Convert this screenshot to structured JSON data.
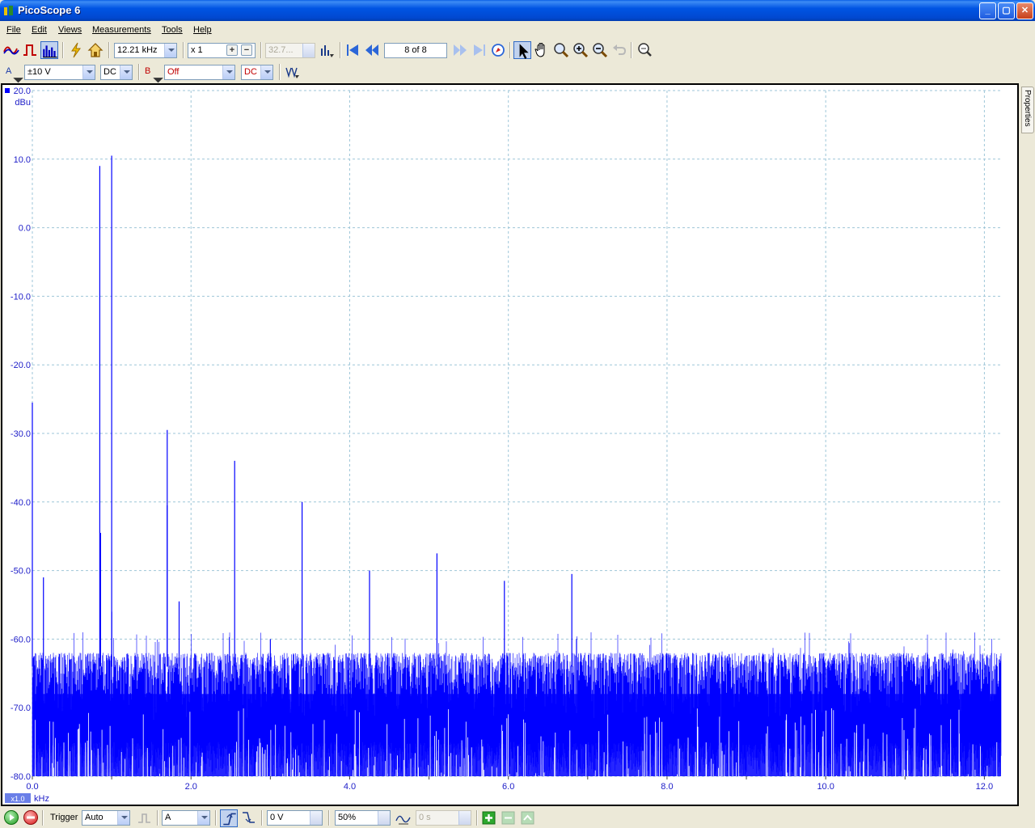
{
  "window": {
    "title": "PicoScope 6"
  },
  "menu": [
    "File",
    "Edit",
    "Views",
    "Measurements",
    "Tools",
    "Help"
  ],
  "toolbar": {
    "frequency": "12.21 kHz",
    "zoom_factor": "x 1",
    "samples": "32.7...",
    "buffer_position": "8 of 8"
  },
  "channels": {
    "a": {
      "label": "A",
      "range": "±10 V",
      "coupling": "DC"
    },
    "b": {
      "label": "B",
      "range": "Off",
      "coupling": "DC"
    }
  },
  "properties_tab": "Properties",
  "trigger": {
    "label": "Trigger",
    "mode": "Auto",
    "source": "A",
    "threshold": "0 V",
    "pre_trigger": "50%",
    "delay": "0 s"
  },
  "chart_data": {
    "type": "line",
    "title": "",
    "xlabel": "kHz",
    "ylabel": "dBu",
    "xlim": [
      0.0,
      12.21
    ],
    "ylim": [
      -80.0,
      20.0
    ],
    "x_ticks": [
      "0.0",
      "2.0",
      "4.0",
      "6.0",
      "8.0",
      "10.0",
      "12.0"
    ],
    "y_ticks": [
      "20.0",
      "10.0",
      "0.0",
      "-10.0",
      "-20.0",
      "-30.0",
      "-40.0",
      "-50.0",
      "-60.0",
      "-70.0",
      "-80.0"
    ],
    "x_scale_badge": "x1.0",
    "grid": true,
    "series": [
      {
        "name": "A",
        "color": "#0000ff",
        "noise_floor_dbu": [
          -75,
          -62
        ],
        "peaks": [
          {
            "x": 0.0,
            "y": -25.5
          },
          {
            "x": 0.14,
            "y": -51.0
          },
          {
            "x": 0.85,
            "y": 9.0
          },
          {
            "x": 0.86,
            "y": -44.5
          },
          {
            "x": 1.0,
            "y": 10.5
          },
          {
            "x": 1.0,
            "y": -56.0
          },
          {
            "x": 1.7,
            "y": -29.5
          },
          {
            "x": 1.7,
            "y": -40.5
          },
          {
            "x": 1.85,
            "y": -54.5
          },
          {
            "x": 2.55,
            "y": -34.0
          },
          {
            "x": 3.0,
            "y": -60.0
          },
          {
            "x": 3.4,
            "y": -40.0
          },
          {
            "x": 4.25,
            "y": -50.0
          },
          {
            "x": 5.1,
            "y": -47.5
          },
          {
            "x": 5.95,
            "y": -51.5
          },
          {
            "x": 6.8,
            "y": -50.5
          }
        ]
      }
    ]
  }
}
